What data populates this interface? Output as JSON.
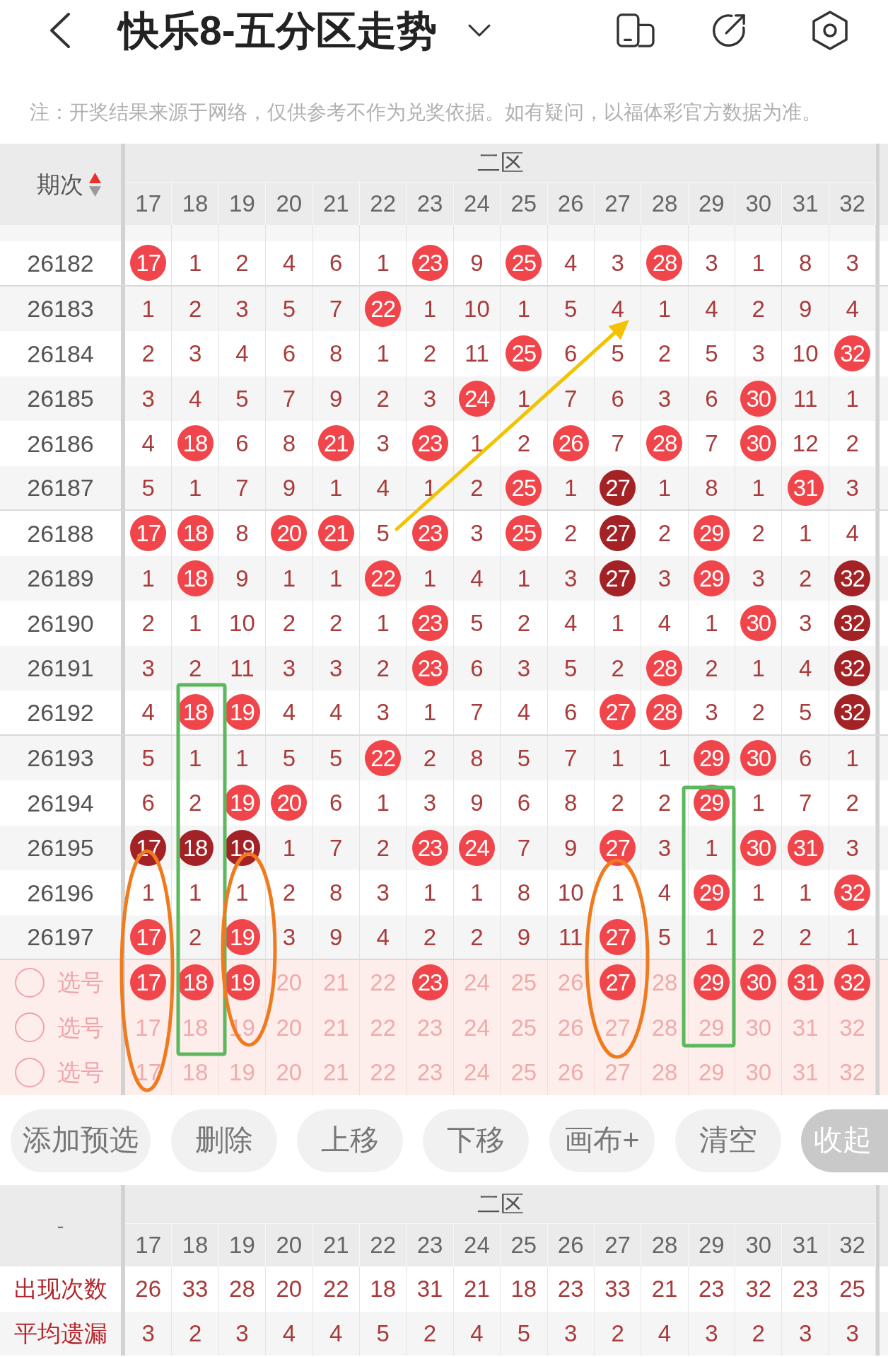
{
  "header": {
    "title": "快乐8-五分区走势"
  },
  "notice": "注：开奖结果来源于网络，仅供参考不作为兑奖依据。如有疑问，以福体彩官方数据为准。",
  "trend_table": {
    "issue_header": "期次",
    "sort_ascending": true,
    "zone": "二区",
    "columns": [
      "17",
      "18",
      "19",
      "20",
      "21",
      "22",
      "23",
      "24",
      "25",
      "26",
      "27",
      "28",
      "29",
      "30",
      "31",
      "32"
    ],
    "rows": [
      {
        "issue": "26182",
        "cells": [
          {
            "text": "17",
            "kind": "hit"
          },
          {
            "text": "1",
            "kind": "miss"
          },
          {
            "text": "2",
            "kind": "miss"
          },
          {
            "text": "4",
            "kind": "miss"
          },
          {
            "text": "6",
            "kind": "miss"
          },
          {
            "text": "1",
            "kind": "miss"
          },
          {
            "text": "23",
            "kind": "hit"
          },
          {
            "text": "9",
            "kind": "miss"
          },
          {
            "text": "25",
            "kind": "hit"
          },
          {
            "text": "4",
            "kind": "miss"
          },
          {
            "text": "3",
            "kind": "miss"
          },
          {
            "text": "28",
            "kind": "hit"
          },
          {
            "text": "3",
            "kind": "miss"
          },
          {
            "text": "1",
            "kind": "miss"
          },
          {
            "text": "8",
            "kind": "miss"
          },
          {
            "text": "3",
            "kind": "miss"
          }
        ]
      },
      {
        "issue": "26183",
        "cells": [
          {
            "text": "1",
            "kind": "miss"
          },
          {
            "text": "2",
            "kind": "miss"
          },
          {
            "text": "3",
            "kind": "miss"
          },
          {
            "text": "5",
            "kind": "miss"
          },
          {
            "text": "7",
            "kind": "miss"
          },
          {
            "text": "22",
            "kind": "hit"
          },
          {
            "text": "1",
            "kind": "miss"
          },
          {
            "text": "10",
            "kind": "miss"
          },
          {
            "text": "1",
            "kind": "miss"
          },
          {
            "text": "5",
            "kind": "miss"
          },
          {
            "text": "4",
            "kind": "miss"
          },
          {
            "text": "1",
            "kind": "miss"
          },
          {
            "text": "4",
            "kind": "miss"
          },
          {
            "text": "2",
            "kind": "miss"
          },
          {
            "text": "9",
            "kind": "miss"
          },
          {
            "text": "4",
            "kind": "miss"
          }
        ]
      },
      {
        "issue": "26184",
        "cells": [
          {
            "text": "2",
            "kind": "miss"
          },
          {
            "text": "3",
            "kind": "miss"
          },
          {
            "text": "4",
            "kind": "miss"
          },
          {
            "text": "6",
            "kind": "miss"
          },
          {
            "text": "8",
            "kind": "miss"
          },
          {
            "text": "1",
            "kind": "miss"
          },
          {
            "text": "2",
            "kind": "miss"
          },
          {
            "text": "11",
            "kind": "miss"
          },
          {
            "text": "25",
            "kind": "hit"
          },
          {
            "text": "6",
            "kind": "miss"
          },
          {
            "text": "5",
            "kind": "miss"
          },
          {
            "text": "2",
            "kind": "miss"
          },
          {
            "text": "5",
            "kind": "miss"
          },
          {
            "text": "3",
            "kind": "miss"
          },
          {
            "text": "10",
            "kind": "miss"
          },
          {
            "text": "32",
            "kind": "hit"
          }
        ]
      },
      {
        "issue": "26185",
        "cells": [
          {
            "text": "3",
            "kind": "miss"
          },
          {
            "text": "4",
            "kind": "miss"
          },
          {
            "text": "5",
            "kind": "miss"
          },
          {
            "text": "7",
            "kind": "miss"
          },
          {
            "text": "9",
            "kind": "miss"
          },
          {
            "text": "2",
            "kind": "miss"
          },
          {
            "text": "3",
            "kind": "miss"
          },
          {
            "text": "24",
            "kind": "hit"
          },
          {
            "text": "1",
            "kind": "miss"
          },
          {
            "text": "7",
            "kind": "miss"
          },
          {
            "text": "6",
            "kind": "miss"
          },
          {
            "text": "3",
            "kind": "miss"
          },
          {
            "text": "6",
            "kind": "miss"
          },
          {
            "text": "30",
            "kind": "hit"
          },
          {
            "text": "11",
            "kind": "miss"
          },
          {
            "text": "1",
            "kind": "miss"
          }
        ]
      },
      {
        "issue": "26186",
        "cells": [
          {
            "text": "4",
            "kind": "miss"
          },
          {
            "text": "18",
            "kind": "hit"
          },
          {
            "text": "6",
            "kind": "miss"
          },
          {
            "text": "8",
            "kind": "miss"
          },
          {
            "text": "21",
            "kind": "hit"
          },
          {
            "text": "3",
            "kind": "miss"
          },
          {
            "text": "23",
            "kind": "hit"
          },
          {
            "text": "1",
            "kind": "miss"
          },
          {
            "text": "2",
            "kind": "miss"
          },
          {
            "text": "26",
            "kind": "hit"
          },
          {
            "text": "7",
            "kind": "miss"
          },
          {
            "text": "28",
            "kind": "hit"
          },
          {
            "text": "7",
            "kind": "miss"
          },
          {
            "text": "30",
            "kind": "hit"
          },
          {
            "text": "12",
            "kind": "miss"
          },
          {
            "text": "2",
            "kind": "miss"
          }
        ]
      },
      {
        "issue": "26187",
        "cells": [
          {
            "text": "5",
            "kind": "miss"
          },
          {
            "text": "1",
            "kind": "miss"
          },
          {
            "text": "7",
            "kind": "miss"
          },
          {
            "text": "9",
            "kind": "miss"
          },
          {
            "text": "1",
            "kind": "miss"
          },
          {
            "text": "4",
            "kind": "miss"
          },
          {
            "text": "1",
            "kind": "miss"
          },
          {
            "text": "2",
            "kind": "miss"
          },
          {
            "text": "25",
            "kind": "hit"
          },
          {
            "text": "1",
            "kind": "miss"
          },
          {
            "text": "27",
            "kind": "streak"
          },
          {
            "text": "1",
            "kind": "miss"
          },
          {
            "text": "8",
            "kind": "miss"
          },
          {
            "text": "1",
            "kind": "miss"
          },
          {
            "text": "31",
            "kind": "hit"
          },
          {
            "text": "3",
            "kind": "miss"
          }
        ]
      },
      {
        "issue": "26188",
        "cells": [
          {
            "text": "17",
            "kind": "hit"
          },
          {
            "text": "18",
            "kind": "hit"
          },
          {
            "text": "8",
            "kind": "miss"
          },
          {
            "text": "20",
            "kind": "hit"
          },
          {
            "text": "21",
            "kind": "hit"
          },
          {
            "text": "5",
            "kind": "miss"
          },
          {
            "text": "23",
            "kind": "hit"
          },
          {
            "text": "3",
            "kind": "miss"
          },
          {
            "text": "25",
            "kind": "hit"
          },
          {
            "text": "2",
            "kind": "miss"
          },
          {
            "text": "27",
            "kind": "streak"
          },
          {
            "text": "2",
            "kind": "miss"
          },
          {
            "text": "29",
            "kind": "hit"
          },
          {
            "text": "2",
            "kind": "miss"
          },
          {
            "text": "1",
            "kind": "miss"
          },
          {
            "text": "4",
            "kind": "miss"
          }
        ]
      },
      {
        "issue": "26189",
        "cells": [
          {
            "text": "1",
            "kind": "miss"
          },
          {
            "text": "18",
            "kind": "hit"
          },
          {
            "text": "9",
            "kind": "miss"
          },
          {
            "text": "1",
            "kind": "miss"
          },
          {
            "text": "1",
            "kind": "miss"
          },
          {
            "text": "22",
            "kind": "hit"
          },
          {
            "text": "1",
            "kind": "miss"
          },
          {
            "text": "4",
            "kind": "miss"
          },
          {
            "text": "1",
            "kind": "miss"
          },
          {
            "text": "3",
            "kind": "miss"
          },
          {
            "text": "27",
            "kind": "streak"
          },
          {
            "text": "3",
            "kind": "miss"
          },
          {
            "text": "29",
            "kind": "hit"
          },
          {
            "text": "3",
            "kind": "miss"
          },
          {
            "text": "2",
            "kind": "miss"
          },
          {
            "text": "32",
            "kind": "streak"
          }
        ]
      },
      {
        "issue": "26190",
        "cells": [
          {
            "text": "2",
            "kind": "miss"
          },
          {
            "text": "1",
            "kind": "miss"
          },
          {
            "text": "10",
            "kind": "miss"
          },
          {
            "text": "2",
            "kind": "miss"
          },
          {
            "text": "2",
            "kind": "miss"
          },
          {
            "text": "1",
            "kind": "miss"
          },
          {
            "text": "23",
            "kind": "hit"
          },
          {
            "text": "5",
            "kind": "miss"
          },
          {
            "text": "2",
            "kind": "miss"
          },
          {
            "text": "4",
            "kind": "miss"
          },
          {
            "text": "1",
            "kind": "miss"
          },
          {
            "text": "4",
            "kind": "miss"
          },
          {
            "text": "1",
            "kind": "miss"
          },
          {
            "text": "30",
            "kind": "hit"
          },
          {
            "text": "3",
            "kind": "miss"
          },
          {
            "text": "32",
            "kind": "streak"
          }
        ]
      },
      {
        "issue": "26191",
        "cells": [
          {
            "text": "3",
            "kind": "miss"
          },
          {
            "text": "2",
            "kind": "miss"
          },
          {
            "text": "11",
            "kind": "miss"
          },
          {
            "text": "3",
            "kind": "miss"
          },
          {
            "text": "3",
            "kind": "miss"
          },
          {
            "text": "2",
            "kind": "miss"
          },
          {
            "text": "23",
            "kind": "hit"
          },
          {
            "text": "6",
            "kind": "miss"
          },
          {
            "text": "3",
            "kind": "miss"
          },
          {
            "text": "5",
            "kind": "miss"
          },
          {
            "text": "2",
            "kind": "miss"
          },
          {
            "text": "28",
            "kind": "hit"
          },
          {
            "text": "2",
            "kind": "miss"
          },
          {
            "text": "1",
            "kind": "miss"
          },
          {
            "text": "4",
            "kind": "miss"
          },
          {
            "text": "32",
            "kind": "streak"
          }
        ]
      },
      {
        "issue": "26192",
        "cells": [
          {
            "text": "4",
            "kind": "miss"
          },
          {
            "text": "18",
            "kind": "hit"
          },
          {
            "text": "19",
            "kind": "hit"
          },
          {
            "text": "4",
            "kind": "miss"
          },
          {
            "text": "4",
            "kind": "miss"
          },
          {
            "text": "3",
            "kind": "miss"
          },
          {
            "text": "1",
            "kind": "miss"
          },
          {
            "text": "7",
            "kind": "miss"
          },
          {
            "text": "4",
            "kind": "miss"
          },
          {
            "text": "6",
            "kind": "miss"
          },
          {
            "text": "27",
            "kind": "hit"
          },
          {
            "text": "28",
            "kind": "hit"
          },
          {
            "text": "3",
            "kind": "miss"
          },
          {
            "text": "2",
            "kind": "miss"
          },
          {
            "text": "5",
            "kind": "miss"
          },
          {
            "text": "32",
            "kind": "streak"
          }
        ]
      },
      {
        "issue": "26193",
        "cells": [
          {
            "text": "5",
            "kind": "miss"
          },
          {
            "text": "1",
            "kind": "miss"
          },
          {
            "text": "1",
            "kind": "miss"
          },
          {
            "text": "5",
            "kind": "miss"
          },
          {
            "text": "5",
            "kind": "miss"
          },
          {
            "text": "22",
            "kind": "hit"
          },
          {
            "text": "2",
            "kind": "miss"
          },
          {
            "text": "8",
            "kind": "miss"
          },
          {
            "text": "5",
            "kind": "miss"
          },
          {
            "text": "7",
            "kind": "miss"
          },
          {
            "text": "1",
            "kind": "miss"
          },
          {
            "text": "1",
            "kind": "miss"
          },
          {
            "text": "29",
            "kind": "hit"
          },
          {
            "text": "30",
            "kind": "hit"
          },
          {
            "text": "6",
            "kind": "miss"
          },
          {
            "text": "1",
            "kind": "miss"
          }
        ]
      },
      {
        "issue": "26194",
        "cells": [
          {
            "text": "6",
            "kind": "miss"
          },
          {
            "text": "2",
            "kind": "miss"
          },
          {
            "text": "19",
            "kind": "hit"
          },
          {
            "text": "20",
            "kind": "hit"
          },
          {
            "text": "6",
            "kind": "miss"
          },
          {
            "text": "1",
            "kind": "miss"
          },
          {
            "text": "3",
            "kind": "miss"
          },
          {
            "text": "9",
            "kind": "miss"
          },
          {
            "text": "6",
            "kind": "miss"
          },
          {
            "text": "8",
            "kind": "miss"
          },
          {
            "text": "2",
            "kind": "miss"
          },
          {
            "text": "2",
            "kind": "miss"
          },
          {
            "text": "29",
            "kind": "hit"
          },
          {
            "text": "1",
            "kind": "miss"
          },
          {
            "text": "7",
            "kind": "miss"
          },
          {
            "text": "2",
            "kind": "miss"
          }
        ]
      },
      {
        "issue": "26195",
        "cells": [
          {
            "text": "17",
            "kind": "streak"
          },
          {
            "text": "18",
            "kind": "streak"
          },
          {
            "text": "19",
            "kind": "streak"
          },
          {
            "text": "1",
            "kind": "miss"
          },
          {
            "text": "7",
            "kind": "miss"
          },
          {
            "text": "2",
            "kind": "miss"
          },
          {
            "text": "23",
            "kind": "hit"
          },
          {
            "text": "24",
            "kind": "hit"
          },
          {
            "text": "7",
            "kind": "miss"
          },
          {
            "text": "9",
            "kind": "miss"
          },
          {
            "text": "27",
            "kind": "hit"
          },
          {
            "text": "3",
            "kind": "miss"
          },
          {
            "text": "1",
            "kind": "miss"
          },
          {
            "text": "30",
            "kind": "hit"
          },
          {
            "text": "31",
            "kind": "hit"
          },
          {
            "text": "3",
            "kind": "miss"
          }
        ]
      },
      {
        "issue": "26196",
        "cells": [
          {
            "text": "1",
            "kind": "miss"
          },
          {
            "text": "1",
            "kind": "miss"
          },
          {
            "text": "1",
            "kind": "miss"
          },
          {
            "text": "2",
            "kind": "miss"
          },
          {
            "text": "8",
            "kind": "miss"
          },
          {
            "text": "3",
            "kind": "miss"
          },
          {
            "text": "1",
            "kind": "miss"
          },
          {
            "text": "1",
            "kind": "miss"
          },
          {
            "text": "8",
            "kind": "miss"
          },
          {
            "text": "10",
            "kind": "miss"
          },
          {
            "text": "1",
            "kind": "miss"
          },
          {
            "text": "4",
            "kind": "miss"
          },
          {
            "text": "29",
            "kind": "hit"
          },
          {
            "text": "1",
            "kind": "miss"
          },
          {
            "text": "1",
            "kind": "miss"
          },
          {
            "text": "32",
            "kind": "hit"
          }
        ]
      },
      {
        "issue": "26197",
        "cells": [
          {
            "text": "17",
            "kind": "hit"
          },
          {
            "text": "2",
            "kind": "miss"
          },
          {
            "text": "19",
            "kind": "hit"
          },
          {
            "text": "3",
            "kind": "miss"
          },
          {
            "text": "9",
            "kind": "miss"
          },
          {
            "text": "4",
            "kind": "miss"
          },
          {
            "text": "2",
            "kind": "miss"
          },
          {
            "text": "2",
            "kind": "miss"
          },
          {
            "text": "9",
            "kind": "miss"
          },
          {
            "text": "11",
            "kind": "miss"
          },
          {
            "text": "27",
            "kind": "hit"
          },
          {
            "text": "5",
            "kind": "miss"
          },
          {
            "text": "1",
            "kind": "miss"
          },
          {
            "text": "2",
            "kind": "miss"
          },
          {
            "text": "2",
            "kind": "miss"
          },
          {
            "text": "1",
            "kind": "miss"
          }
        ]
      }
    ],
    "pick_rows": [
      {
        "label": "选号",
        "checked": false,
        "cells": [
          {
            "text": "17",
            "selected": true
          },
          {
            "text": "18",
            "selected": true
          },
          {
            "text": "19",
            "selected": true
          },
          {
            "text": "20",
            "selected": false
          },
          {
            "text": "21",
            "selected": false
          },
          {
            "text": "22",
            "selected": false
          },
          {
            "text": "23",
            "selected": true
          },
          {
            "text": "24",
            "selected": false
          },
          {
            "text": "25",
            "selected": false
          },
          {
            "text": "26",
            "selected": false
          },
          {
            "text": "27",
            "selected": true
          },
          {
            "text": "28",
            "selected": false
          },
          {
            "text": "29",
            "selected": true
          },
          {
            "text": "30",
            "selected": true
          },
          {
            "text": "31",
            "selected": true
          },
          {
            "text": "32",
            "selected": true
          }
        ]
      },
      {
        "label": "选号",
        "checked": false,
        "cells": [
          {
            "text": "17",
            "selected": false
          },
          {
            "text": "18",
            "selected": false
          },
          {
            "text": "19",
            "selected": false
          },
          {
            "text": "20",
            "selected": false
          },
          {
            "text": "21",
            "selected": false
          },
          {
            "text": "22",
            "selected": false
          },
          {
            "text": "23",
            "selected": false
          },
          {
            "text": "24",
            "selected": false
          },
          {
            "text": "25",
            "selected": false
          },
          {
            "text": "26",
            "selected": false
          },
          {
            "text": "27",
            "selected": false
          },
          {
            "text": "28",
            "selected": false
          },
          {
            "text": "29",
            "selected": false
          },
          {
            "text": "30",
            "selected": false
          },
          {
            "text": "31",
            "selected": false
          },
          {
            "text": "32",
            "selected": false
          }
        ]
      },
      {
        "label": "选号",
        "checked": false,
        "cells": [
          {
            "text": "17",
            "selected": false
          },
          {
            "text": "18",
            "selected": false
          },
          {
            "text": "19",
            "selected": false
          },
          {
            "text": "20",
            "selected": false
          },
          {
            "text": "21",
            "selected": false
          },
          {
            "text": "22",
            "selected": false
          },
          {
            "text": "23",
            "selected": false
          },
          {
            "text": "24",
            "selected": false
          },
          {
            "text": "25",
            "selected": false
          },
          {
            "text": "26",
            "selected": false
          },
          {
            "text": "27",
            "selected": false
          },
          {
            "text": "28",
            "selected": false
          },
          {
            "text": "29",
            "selected": false
          },
          {
            "text": "30",
            "selected": false
          },
          {
            "text": "31",
            "selected": false
          },
          {
            "text": "32",
            "selected": false
          }
        ]
      }
    ]
  },
  "annotations": [
    {
      "kind": "arrow",
      "color": "#f2c300"
    },
    {
      "kind": "rectangle",
      "color": "#5cb85c"
    },
    {
      "kind": "rectangle",
      "color": "#5cb85c"
    },
    {
      "kind": "ellipse",
      "color": "#f07a1e"
    },
    {
      "kind": "ellipse",
      "color": "#f07a1e"
    },
    {
      "kind": "ellipse",
      "color": "#f07a1e"
    }
  ],
  "buttons": [
    {
      "label": "添加预选",
      "kind": "action"
    },
    {
      "label": "删除",
      "kind": "action"
    },
    {
      "label": "上移",
      "kind": "action"
    },
    {
      "label": "下移",
      "kind": "action"
    },
    {
      "label": "画布+",
      "kind": "action"
    },
    {
      "label": "清空",
      "kind": "action"
    },
    {
      "label": "收起",
      "kind": "collapse"
    }
  ],
  "stats_table": {
    "corner": "-",
    "zone": "二区",
    "columns": [
      "17",
      "18",
      "19",
      "20",
      "21",
      "22",
      "23",
      "24",
      "25",
      "26",
      "27",
      "28",
      "29",
      "30",
      "31",
      "32"
    ],
    "rows": [
      {
        "label": "出现次数",
        "values": [
          "26",
          "33",
          "28",
          "20",
          "22",
          "18",
          "31",
          "21",
          "18",
          "23",
          "33",
          "21",
          "23",
          "32",
          "23",
          "25"
        ]
      },
      {
        "label": "平均遗漏",
        "values": [
          "3",
          "2",
          "3",
          "4",
          "4",
          "5",
          "2",
          "4",
          "5",
          "3",
          "2",
          "4",
          "3",
          "2",
          "3",
          "3"
        ]
      }
    ]
  }
}
